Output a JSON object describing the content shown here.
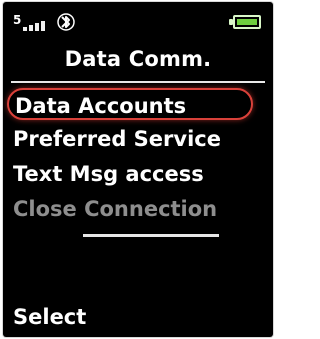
{
  "status_bar": {
    "signal_label": "5",
    "signal_bars": 4,
    "bluetooth_icon": "bluetooth-icon",
    "battery_level": 1.0,
    "battery_color": "#6ecf3e"
  },
  "screen": {
    "title": "Data Comm."
  },
  "menu": {
    "items": [
      {
        "label": "Data Accounts",
        "selected": true,
        "enabled": true
      },
      {
        "label": "Preferred Service",
        "selected": false,
        "enabled": true
      },
      {
        "label": "Text Msg access",
        "selected": false,
        "enabled": true
      },
      {
        "label": "Close Connection",
        "selected": false,
        "enabled": false
      }
    ],
    "selection_color": "#d9413a",
    "disabled_color": "#8e8e8e"
  },
  "softkeys": {
    "left": "Select"
  }
}
